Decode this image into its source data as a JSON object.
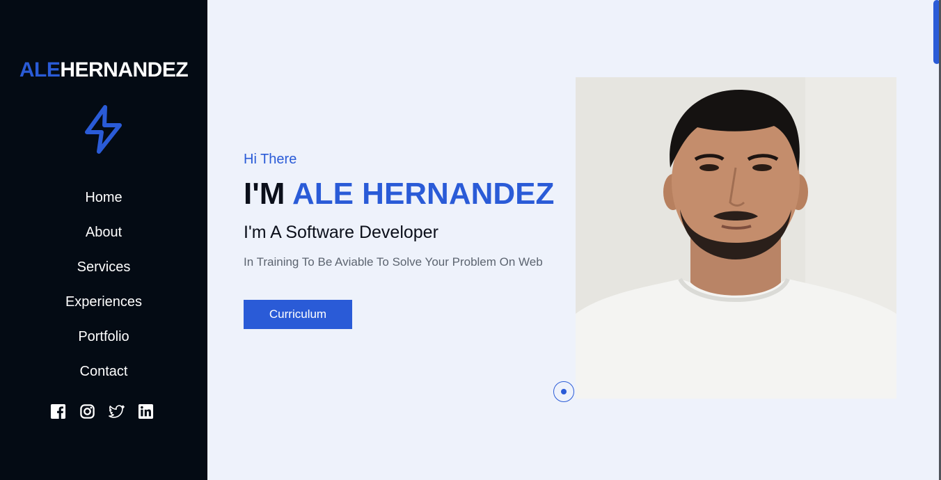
{
  "sidebar": {
    "logo_accent": "ALE",
    "logo_rest": "HERNANDEZ",
    "nav": [
      {
        "label": "Home"
      },
      {
        "label": "About"
      },
      {
        "label": "Services"
      },
      {
        "label": "Experiences"
      },
      {
        "label": "Portfolio"
      },
      {
        "label": "Contact"
      }
    ],
    "socials": [
      "facebook-icon",
      "instagram-icon",
      "twitter-icon",
      "linkedin-icon"
    ]
  },
  "hero": {
    "greeting": "Hi There",
    "headline_prefix": "I'M ",
    "headline_name": "ALE HERNANDEZ",
    "role": "I'm A Software Developer",
    "description": "In Training To Be Aviable To Solve Your Problem On Web",
    "button_label": "Curriculum"
  },
  "colors": {
    "accent": "#2a5bd7",
    "sidebar_bg": "#040b14",
    "main_bg": "#eef2fb"
  }
}
